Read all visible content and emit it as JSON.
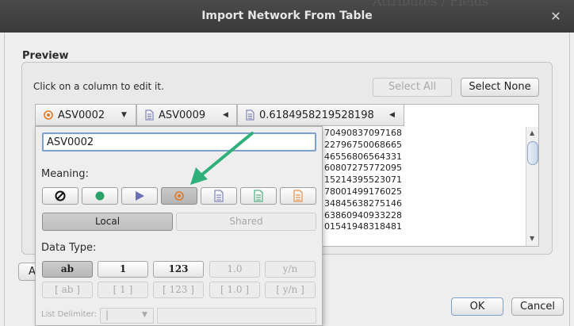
{
  "window": {
    "title": "Import Network From Table",
    "background_title": "Attributes / Fields"
  },
  "preview": {
    "label": "Preview",
    "hint": "Click on a column to edit it.",
    "select_all": "Select All",
    "select_none": "Select None"
  },
  "columns": [
    {
      "name": "ASV0002",
      "icon": "target-icon"
    },
    {
      "name": "ASV0009",
      "icon": "document-icon"
    },
    {
      "name": "0.6184958219528198",
      "icon": "document-icon"
    }
  ],
  "cells": [
    "70490837097168",
    "22796750068665",
    "46556806564331",
    "60807275772095",
    "15214395523071",
    "78001499176025",
    "34845638275146",
    "63860940933228",
    "01541948318481"
  ],
  "editor": {
    "name_value": "ASV0002",
    "meaning_label": "Meaning:",
    "meanings": [
      {
        "icon": "not-allowed-icon"
      },
      {
        "icon": "source-node-icon"
      },
      {
        "icon": "interaction-icon"
      },
      {
        "icon": "target-node-icon",
        "selected": true
      },
      {
        "icon": "node-attribute-icon"
      },
      {
        "icon": "edge-attribute-icon"
      },
      {
        "icon": "network-attribute-icon"
      }
    ],
    "scope_local": "Local",
    "scope_shared": "Shared",
    "data_type_label": "Data Type:",
    "types_row1": [
      {
        "label": "ab",
        "selected": true
      },
      {
        "label": "1"
      },
      {
        "label": "123"
      },
      {
        "label": "1.0",
        "disabled": true
      },
      {
        "label": "y/n",
        "disabled": true
      }
    ],
    "types_row2": [
      {
        "label": "[ ab ]",
        "disabled": true
      },
      {
        "label": "[ 1 ]",
        "disabled": true
      },
      {
        "label": "[ 123 ]",
        "disabled": true
      },
      {
        "label": "[ 1.0 ]",
        "disabled": true
      },
      {
        "label": "[ y/n ]",
        "disabled": true
      }
    ],
    "list_delimiter_label": "List Delimiter:",
    "list_delimiter_value": "|"
  },
  "footer": {
    "partial_button": "A",
    "ok": "OK",
    "cancel": "Cancel"
  },
  "colors": {
    "accent_green": "#2fb07a",
    "target_orange": "#e07a2b",
    "selected_blue": "#7ea1cc"
  }
}
